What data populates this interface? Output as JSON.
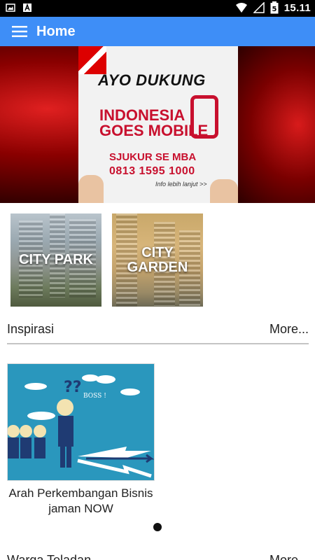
{
  "status_bar": {
    "time": "15.11",
    "battery_level": "5",
    "icons": [
      "image-icon",
      "notification-a-icon",
      "wifi-icon",
      "signal-icon",
      "battery-icon"
    ]
  },
  "app_bar": {
    "title": "Home",
    "color": "#3e8ef7"
  },
  "banner": {
    "headline": "AYO DUKUNG",
    "subheadline": "INDONESIA GOES MOBILE",
    "name": "SJUKUR SE MBA",
    "phone": "0813 1595 1000",
    "info": "Info lebih lanjut >>",
    "slide_count": 4,
    "active_slide": 1
  },
  "tiles": [
    {
      "label": "CITY PARK"
    },
    {
      "label": "CITY GARDEN"
    }
  ],
  "sections": [
    {
      "title": "Inspirasi",
      "more": "More..."
    },
    {
      "title": "Warga Teladan",
      "more": "More..."
    }
  ],
  "articles": [
    {
      "title": "Arah Perkembangan Bisnis jaman NOW",
      "image_caption": "BOSS !"
    }
  ]
}
